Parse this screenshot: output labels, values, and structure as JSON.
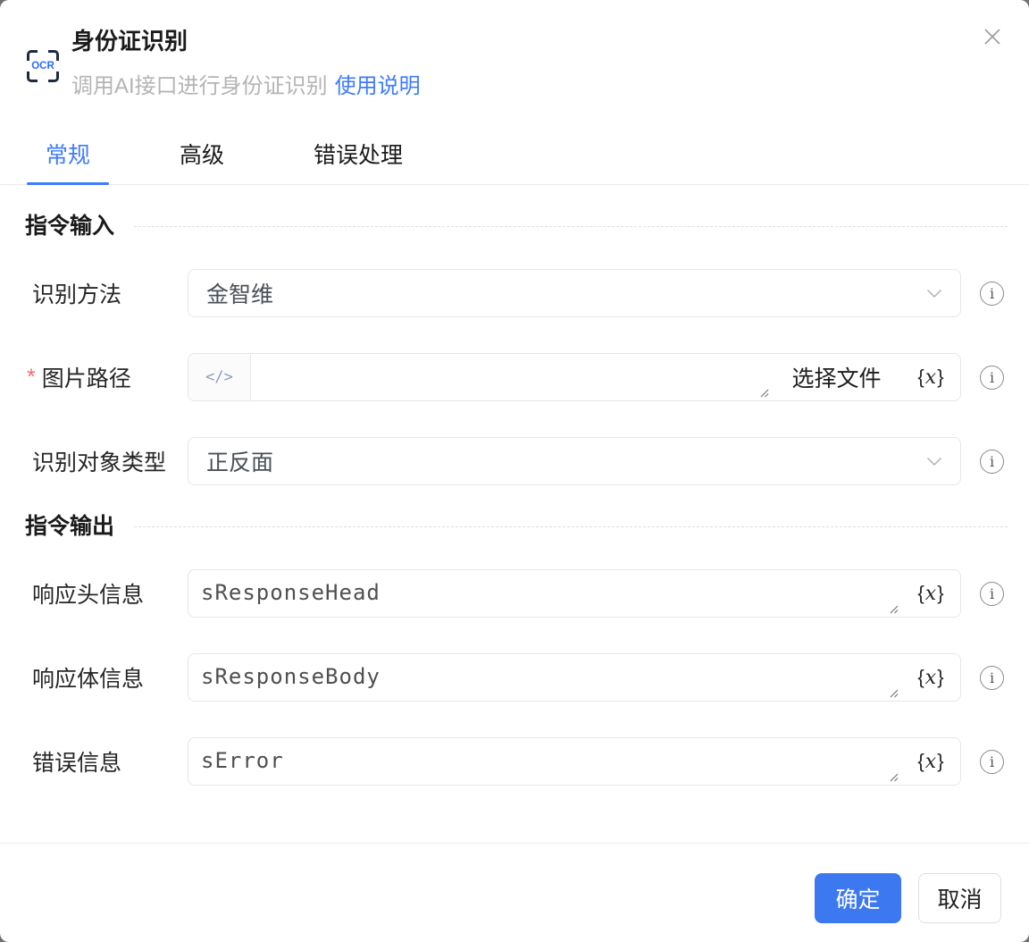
{
  "dialog": {
    "header": {
      "icon_label": "OCR",
      "title": "身份证识别",
      "subtitle": "调用AI接口进行身份证识别",
      "help_link": "使用说明"
    },
    "tabs": [
      {
        "label": "常规"
      },
      {
        "label": "高级"
      },
      {
        "label": "错误处理"
      }
    ],
    "active_tab": "常规",
    "input_section": {
      "title": "指令输入",
      "required_mark": "*",
      "fields": {
        "method": {
          "label": "识别方法",
          "value": "金智维"
        },
        "image_path": {
          "label": "图片路径",
          "value": "",
          "prefix_glyph": "</>",
          "file_button": "选择文件"
        },
        "target_type": {
          "label": "识别对象类型",
          "value": "正反面"
        }
      }
    },
    "output_section": {
      "title": "指令输出",
      "fields": {
        "response_head": {
          "label": "响应头信息",
          "value": "sResponseHead"
        },
        "response_body": {
          "label": "响应体信息",
          "value": "sResponseBody"
        },
        "error": {
          "label": "错误信息",
          "value": "sError"
        }
      }
    },
    "fx_button": {
      "open": "{",
      "var": "x",
      "close": "}"
    },
    "info_glyph": "i",
    "footer": {
      "confirm": "确定",
      "cancel": "取消"
    },
    "colors": {
      "accent": "#3d7bff",
      "button_blue": "#3c78f0",
      "required_red": "#f56c6c",
      "subtitle_gray": "#b4b4b4"
    }
  }
}
